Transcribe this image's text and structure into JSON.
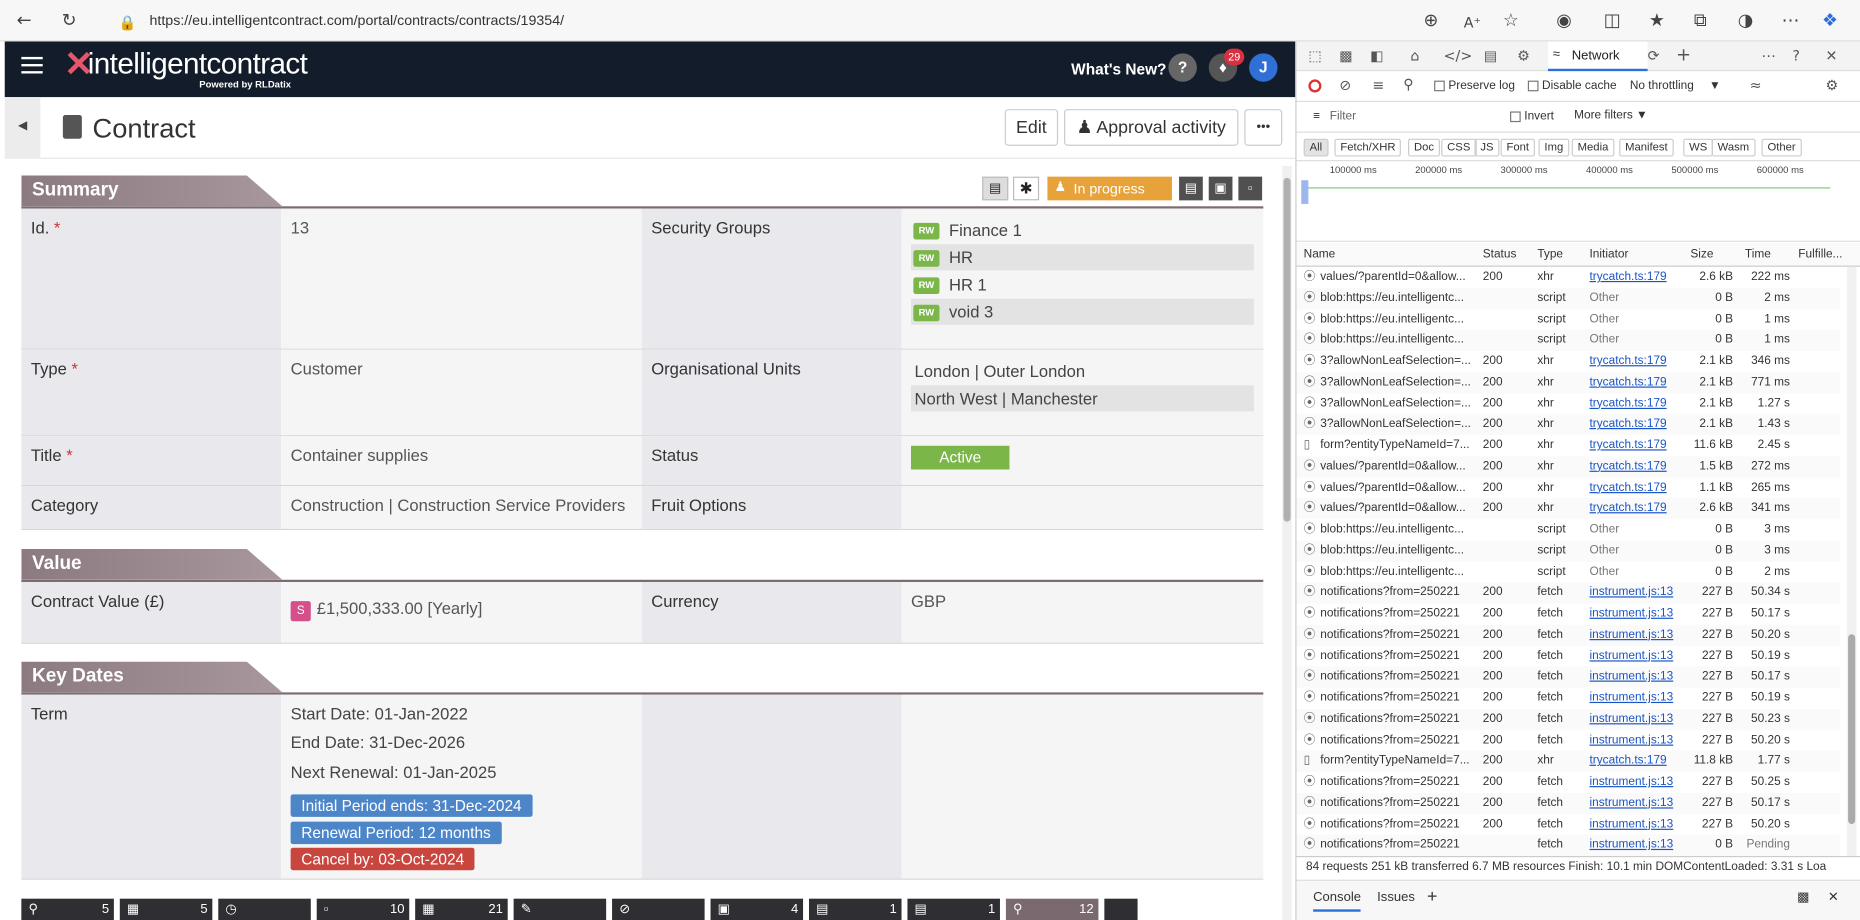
{
  "browser": {
    "url": "https://eu.intelligentcontract.com/portal/contracts/contracts/19354/"
  },
  "app_header": {
    "logo": "intelligentcontract",
    "powered_by": "Powered by RLDatix",
    "whats_new": "What's New?",
    "help": "?",
    "notification_count": "29",
    "avatar_initial": "J"
  },
  "page": {
    "title": "Contract",
    "edit_label": "Edit",
    "approval_label": "Approval activity",
    "more_label": "•••"
  },
  "summary": {
    "heading": "Summary",
    "status_pill": "In progress",
    "id_label": "Id.",
    "id_value": "13",
    "security_groups_label": "Security Groups",
    "security_groups": [
      {
        "tag": "RW",
        "name": "Finance 1"
      },
      {
        "tag": "RW",
        "name": "HR"
      },
      {
        "tag": "RW",
        "name": "HR 1"
      },
      {
        "tag": "RW",
        "name": "void 3"
      }
    ],
    "type_label": "Type",
    "type_value": "Customer",
    "org_units_label": "Organisational Units",
    "org_units": [
      "London | Outer London",
      "North West | Manchester"
    ],
    "title_label": "Title",
    "title_value": "Container supplies",
    "status_label": "Status",
    "status_value": "Active",
    "category_label": "Category",
    "category_value": "Construction | Construction Service Providers",
    "fruit_label": "Fruit Options",
    "fruit_value": "",
    "required_mark": "*"
  },
  "value": {
    "heading": "Value",
    "contract_value_label": "Contract Value (£)",
    "contract_value_badge": "S",
    "contract_value": "£1,500,333.00 [Yearly]",
    "currency_label": "Currency",
    "currency_value": "GBP"
  },
  "key_dates": {
    "heading": "Key Dates",
    "term_label": "Term",
    "start": "Start Date: 01-Jan-2022",
    "end": "End Date: 31-Dec-2026",
    "next_renewal": "Next Renewal: 01-Jan-2025",
    "initial_period": "Initial Period ends: 31-Dec-2024",
    "renewal_period": "Renewal Period: 12 months",
    "cancel_by": "Cancel by: 03-Oct-2024"
  },
  "footer_tabs": [
    {
      "count": "5"
    },
    {
      "count": "5"
    },
    {
      "count": ""
    },
    {
      "count": "10"
    },
    {
      "count": "21"
    },
    {
      "count": ""
    },
    {
      "count": ""
    },
    {
      "count": "4"
    },
    {
      "count": "1"
    },
    {
      "count": "1"
    },
    {
      "count": "12"
    }
  ],
  "devtools": {
    "network_tab": "Network",
    "preserve_log": "Preserve log",
    "disable_cache": "Disable cache",
    "throttling": "No throttling",
    "filter_placeholder": "Filter",
    "invert": "Invert",
    "more_filters": "More filters",
    "types": [
      "All",
      "Fetch/XHR",
      "Doc",
      "CSS",
      "JS",
      "Font",
      "Img",
      "Media",
      "Manifest",
      "WS",
      "Wasm",
      "Other"
    ],
    "timeline_labels": [
      "100000 ms",
      "200000 ms",
      "300000 ms",
      "400000 ms",
      "500000 ms",
      "600000 ms"
    ],
    "columns": [
      "Name",
      "Status",
      "Type",
      "Initiator",
      "Size",
      "Time",
      "Fulfille..."
    ],
    "rows": [
      {
        "name": "values/?parentId=0&allow...",
        "status": "200",
        "type": "xhr",
        "initiator": "trycatch.ts:179",
        "size": "2.6 kB",
        "time": "222 ms"
      },
      {
        "name": "blob:https://eu.intelligentc...",
        "status": "",
        "type": "script",
        "initiator": "Other",
        "size": "0 B",
        "time": "2 ms"
      },
      {
        "name": "blob:https://eu.intelligentc...",
        "status": "",
        "type": "script",
        "initiator": "Other",
        "size": "0 B",
        "time": "1 ms"
      },
      {
        "name": "blob:https://eu.intelligentc...",
        "status": "",
        "type": "script",
        "initiator": "Other",
        "size": "0 B",
        "time": "1 ms"
      },
      {
        "name": "3?allowNonLeafSelection=...",
        "status": "200",
        "type": "xhr",
        "initiator": "trycatch.ts:179",
        "size": "2.1 kB",
        "time": "346 ms"
      },
      {
        "name": "3?allowNonLeafSelection=...",
        "status": "200",
        "type": "xhr",
        "initiator": "trycatch.ts:179",
        "size": "2.1 kB",
        "time": "771 ms"
      },
      {
        "name": "3?allowNonLeafSelection=...",
        "status": "200",
        "type": "xhr",
        "initiator": "trycatch.ts:179",
        "size": "2.1 kB",
        "time": "1.27 s"
      },
      {
        "name": "3?allowNonLeafSelection=...",
        "status": "200",
        "type": "xhr",
        "initiator": "trycatch.ts:179",
        "size": "2.1 kB",
        "time": "1.43 s"
      },
      {
        "name": "form?entityTypeNameId=7...",
        "status": "200",
        "type": "xhr",
        "initiator": "trycatch.ts:179",
        "size": "11.6 kB",
        "time": "2.45 s"
      },
      {
        "name": "values/?parentId=0&allow...",
        "status": "200",
        "type": "xhr",
        "initiator": "trycatch.ts:179",
        "size": "1.5 kB",
        "time": "272 ms"
      },
      {
        "name": "values/?parentId=0&allow...",
        "status": "200",
        "type": "xhr",
        "initiator": "trycatch.ts:179",
        "size": "1.1 kB",
        "time": "265 ms"
      },
      {
        "name": "values/?parentId=0&allow...",
        "status": "200",
        "type": "xhr",
        "initiator": "trycatch.ts:179",
        "size": "2.6 kB",
        "time": "341 ms"
      },
      {
        "name": "blob:https://eu.intelligentc...",
        "status": "",
        "type": "script",
        "initiator": "Other",
        "size": "0 B",
        "time": "3 ms"
      },
      {
        "name": "blob:https://eu.intelligentc...",
        "status": "",
        "type": "script",
        "initiator": "Other",
        "size": "0 B",
        "time": "3 ms"
      },
      {
        "name": "blob:https://eu.intelligentc...",
        "status": "",
        "type": "script",
        "initiator": "Other",
        "size": "0 B",
        "time": "2 ms"
      },
      {
        "name": "notifications?from=250221",
        "status": "200",
        "type": "fetch",
        "initiator": "instrument.js:13",
        "size": "227 B",
        "time": "50.34 s"
      },
      {
        "name": "notifications?from=250221",
        "status": "200",
        "type": "fetch",
        "initiator": "instrument.js:13",
        "size": "227 B",
        "time": "50.17 s"
      },
      {
        "name": "notifications?from=250221",
        "status": "200",
        "type": "fetch",
        "initiator": "instrument.js:13",
        "size": "227 B",
        "time": "50.20 s"
      },
      {
        "name": "notifications?from=250221",
        "status": "200",
        "type": "fetch",
        "initiator": "instrument.js:13",
        "size": "227 B",
        "time": "50.19 s"
      },
      {
        "name": "notifications?from=250221",
        "status": "200",
        "type": "fetch",
        "initiator": "instrument.js:13",
        "size": "227 B",
        "time": "50.17 s"
      },
      {
        "name": "notifications?from=250221",
        "status": "200",
        "type": "fetch",
        "initiator": "instrument.js:13",
        "size": "227 B",
        "time": "50.19 s"
      },
      {
        "name": "notifications?from=250221",
        "status": "200",
        "type": "fetch",
        "initiator": "instrument.js:13",
        "size": "227 B",
        "time": "50.23 s"
      },
      {
        "name": "notifications?from=250221",
        "status": "200",
        "type": "fetch",
        "initiator": "instrument.js:13",
        "size": "227 B",
        "time": "50.20 s"
      },
      {
        "name": "form?entityTypeNameId=7...",
        "status": "200",
        "type": "xhr",
        "initiator": "trycatch.ts:179",
        "size": "11.8 kB",
        "time": "1.77 s"
      },
      {
        "name": "notifications?from=250221",
        "status": "200",
        "type": "fetch",
        "initiator": "instrument.js:13",
        "size": "227 B",
        "time": "50.25 s"
      },
      {
        "name": "notifications?from=250221",
        "status": "200",
        "type": "fetch",
        "initiator": "instrument.js:13",
        "size": "227 B",
        "time": "50.17 s"
      },
      {
        "name": "notifications?from=250221",
        "status": "200",
        "type": "fetch",
        "initiator": "instrument.js:13",
        "size": "227 B",
        "time": "50.20 s"
      },
      {
        "name": "notifications?from=250221",
        "status": "",
        "type": "fetch",
        "initiator": "instrument.js:13",
        "size": "0 B",
        "time": "Pending"
      }
    ],
    "status_bar": "84 requests  251 kB transferred  6.7 MB resources  Finish: 10.1 min  DOMContentLoaded: 3.31 s  Loa",
    "console_tab": "Console",
    "issues_tab": "Issues"
  }
}
